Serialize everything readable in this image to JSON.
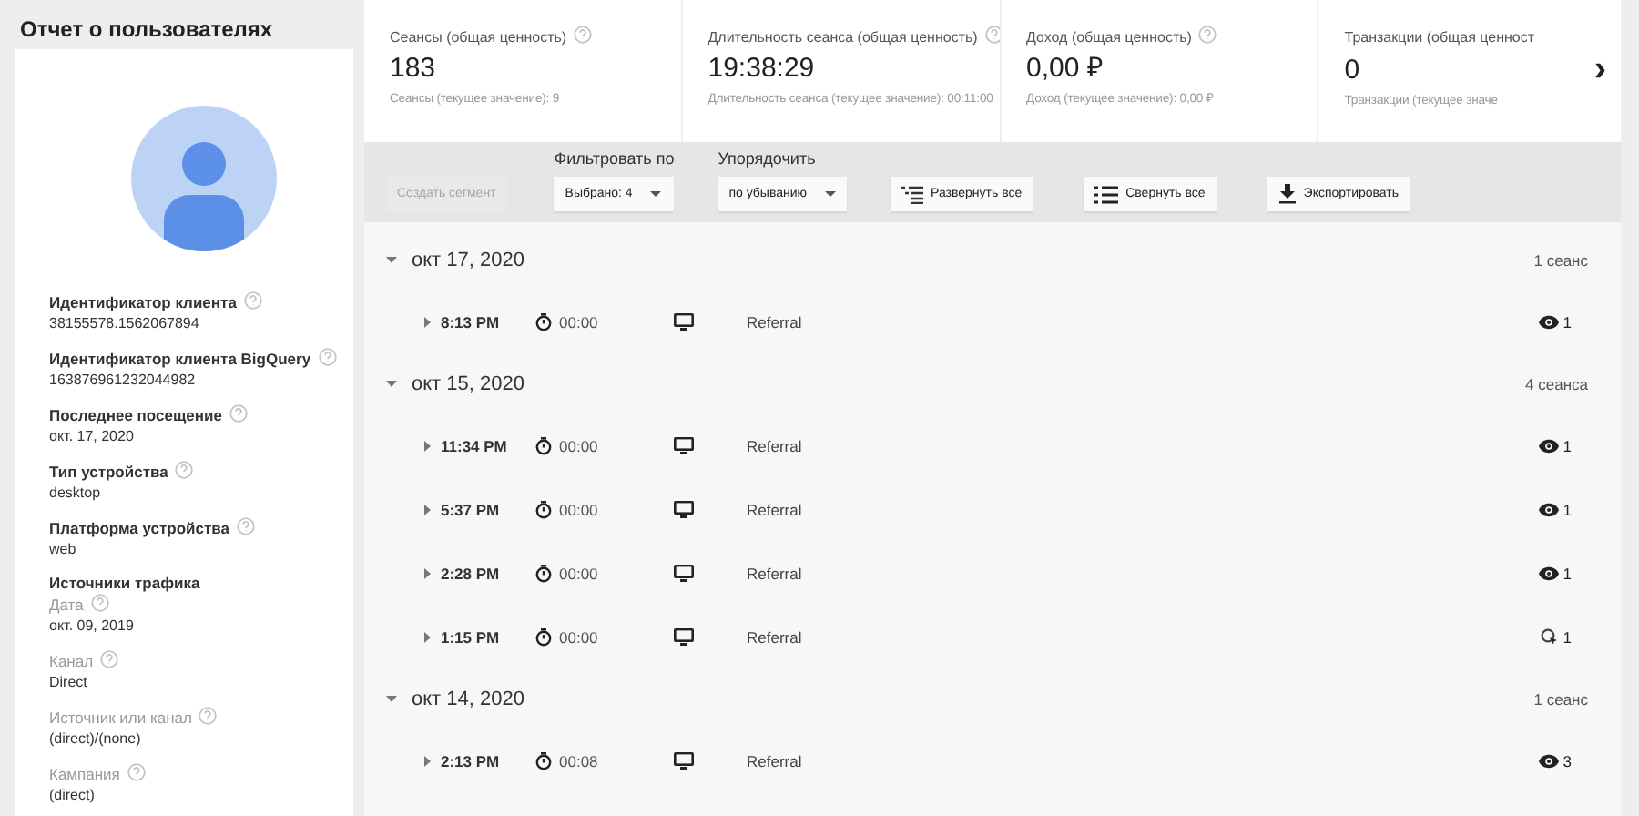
{
  "sidebar": {
    "title": "Отчет о пользователях",
    "fields": [
      {
        "kind": "main",
        "label": "Идентификатор клиента",
        "value": "38155578.1562067894"
      },
      {
        "kind": "main",
        "label": "Идентификатор клиента BigQuery",
        "value": "163876961232044982"
      },
      {
        "kind": "main",
        "label": "Последнее посещение",
        "value": "окт. 17, 2020"
      },
      {
        "kind": "main",
        "label": "Тип устройства",
        "value": "desktop"
      },
      {
        "kind": "main",
        "label": "Платформа устройства",
        "value": "web"
      },
      {
        "kind": "heading",
        "label": "Источники трафика"
      },
      {
        "kind": "sub",
        "label": "Дата",
        "value": "окт. 09, 2019"
      },
      {
        "kind": "sub",
        "label": "Канал",
        "value": "Direct"
      },
      {
        "kind": "sub",
        "label": "Источник или канал",
        "value": "(direct)/(none)"
      },
      {
        "kind": "sub",
        "label": "Кампания",
        "value": "(direct)"
      }
    ]
  },
  "metrics": [
    {
      "label": "Сеансы (общая ценность)",
      "value": "183",
      "current": "Сеансы (текущее значение): 9"
    },
    {
      "label": "Длительность сеанса (общая ценность)",
      "value": "19:38:29",
      "current": "Длительность сеанса (текущее значение): 00:11:00"
    },
    {
      "label": "Доход (общая ценность)",
      "value": "0,00 ₽",
      "current": "Доход (текущее значение): 0,00 ₽"
    },
    {
      "label": "Транзакции (общая ценност",
      "value": "0",
      "current": "Транзакции (текущее значе"
    }
  ],
  "next_arrow": "›",
  "toolbar": {
    "segment_button": {
      "label": "Создать сегмент",
      "disabled": true
    },
    "filter": {
      "label": "Фильтровать по",
      "value": "Выбрано: 4"
    },
    "sort": {
      "label": "Упорядочить",
      "value": "по убыванию"
    },
    "buttons": [
      {
        "kind": "expand",
        "label": "Развернуть все"
      },
      {
        "kind": "collapse",
        "label": "Свернуть все"
      },
      {
        "kind": "export",
        "label": "Экспортировать"
      }
    ]
  },
  "days": [
    {
      "date": "окт 17, 2020",
      "count": "1 сеанс",
      "expanded": true,
      "sessions": [
        {
          "time": "8:13 PM",
          "duration": "00:00",
          "source": "Referral",
          "kind": "pageview",
          "hits": "1"
        }
      ]
    },
    {
      "date": "окт 15, 2020",
      "count": "4 сеанса",
      "expanded": true,
      "sessions": [
        {
          "time": "11:34 PM",
          "duration": "00:00",
          "source": "Referral",
          "kind": "pageview",
          "hits": "1"
        },
        {
          "time": "5:37 PM",
          "duration": "00:00",
          "source": "Referral",
          "kind": "pageview",
          "hits": "1"
        },
        {
          "time": "2:28 PM",
          "duration": "00:00",
          "source": "Referral",
          "kind": "pageview",
          "hits": "1"
        },
        {
          "time": "1:15 PM",
          "duration": "00:00",
          "source": "Referral",
          "kind": "event",
          "hits": "1"
        }
      ]
    },
    {
      "date": "окт 14, 2020",
      "count": "1 сеанс",
      "expanded": true,
      "sessions": [
        {
          "time": "2:13 PM",
          "duration": "00:08",
          "source": "Referral",
          "kind": "pageview",
          "hits": "3"
        }
      ]
    }
  ]
}
